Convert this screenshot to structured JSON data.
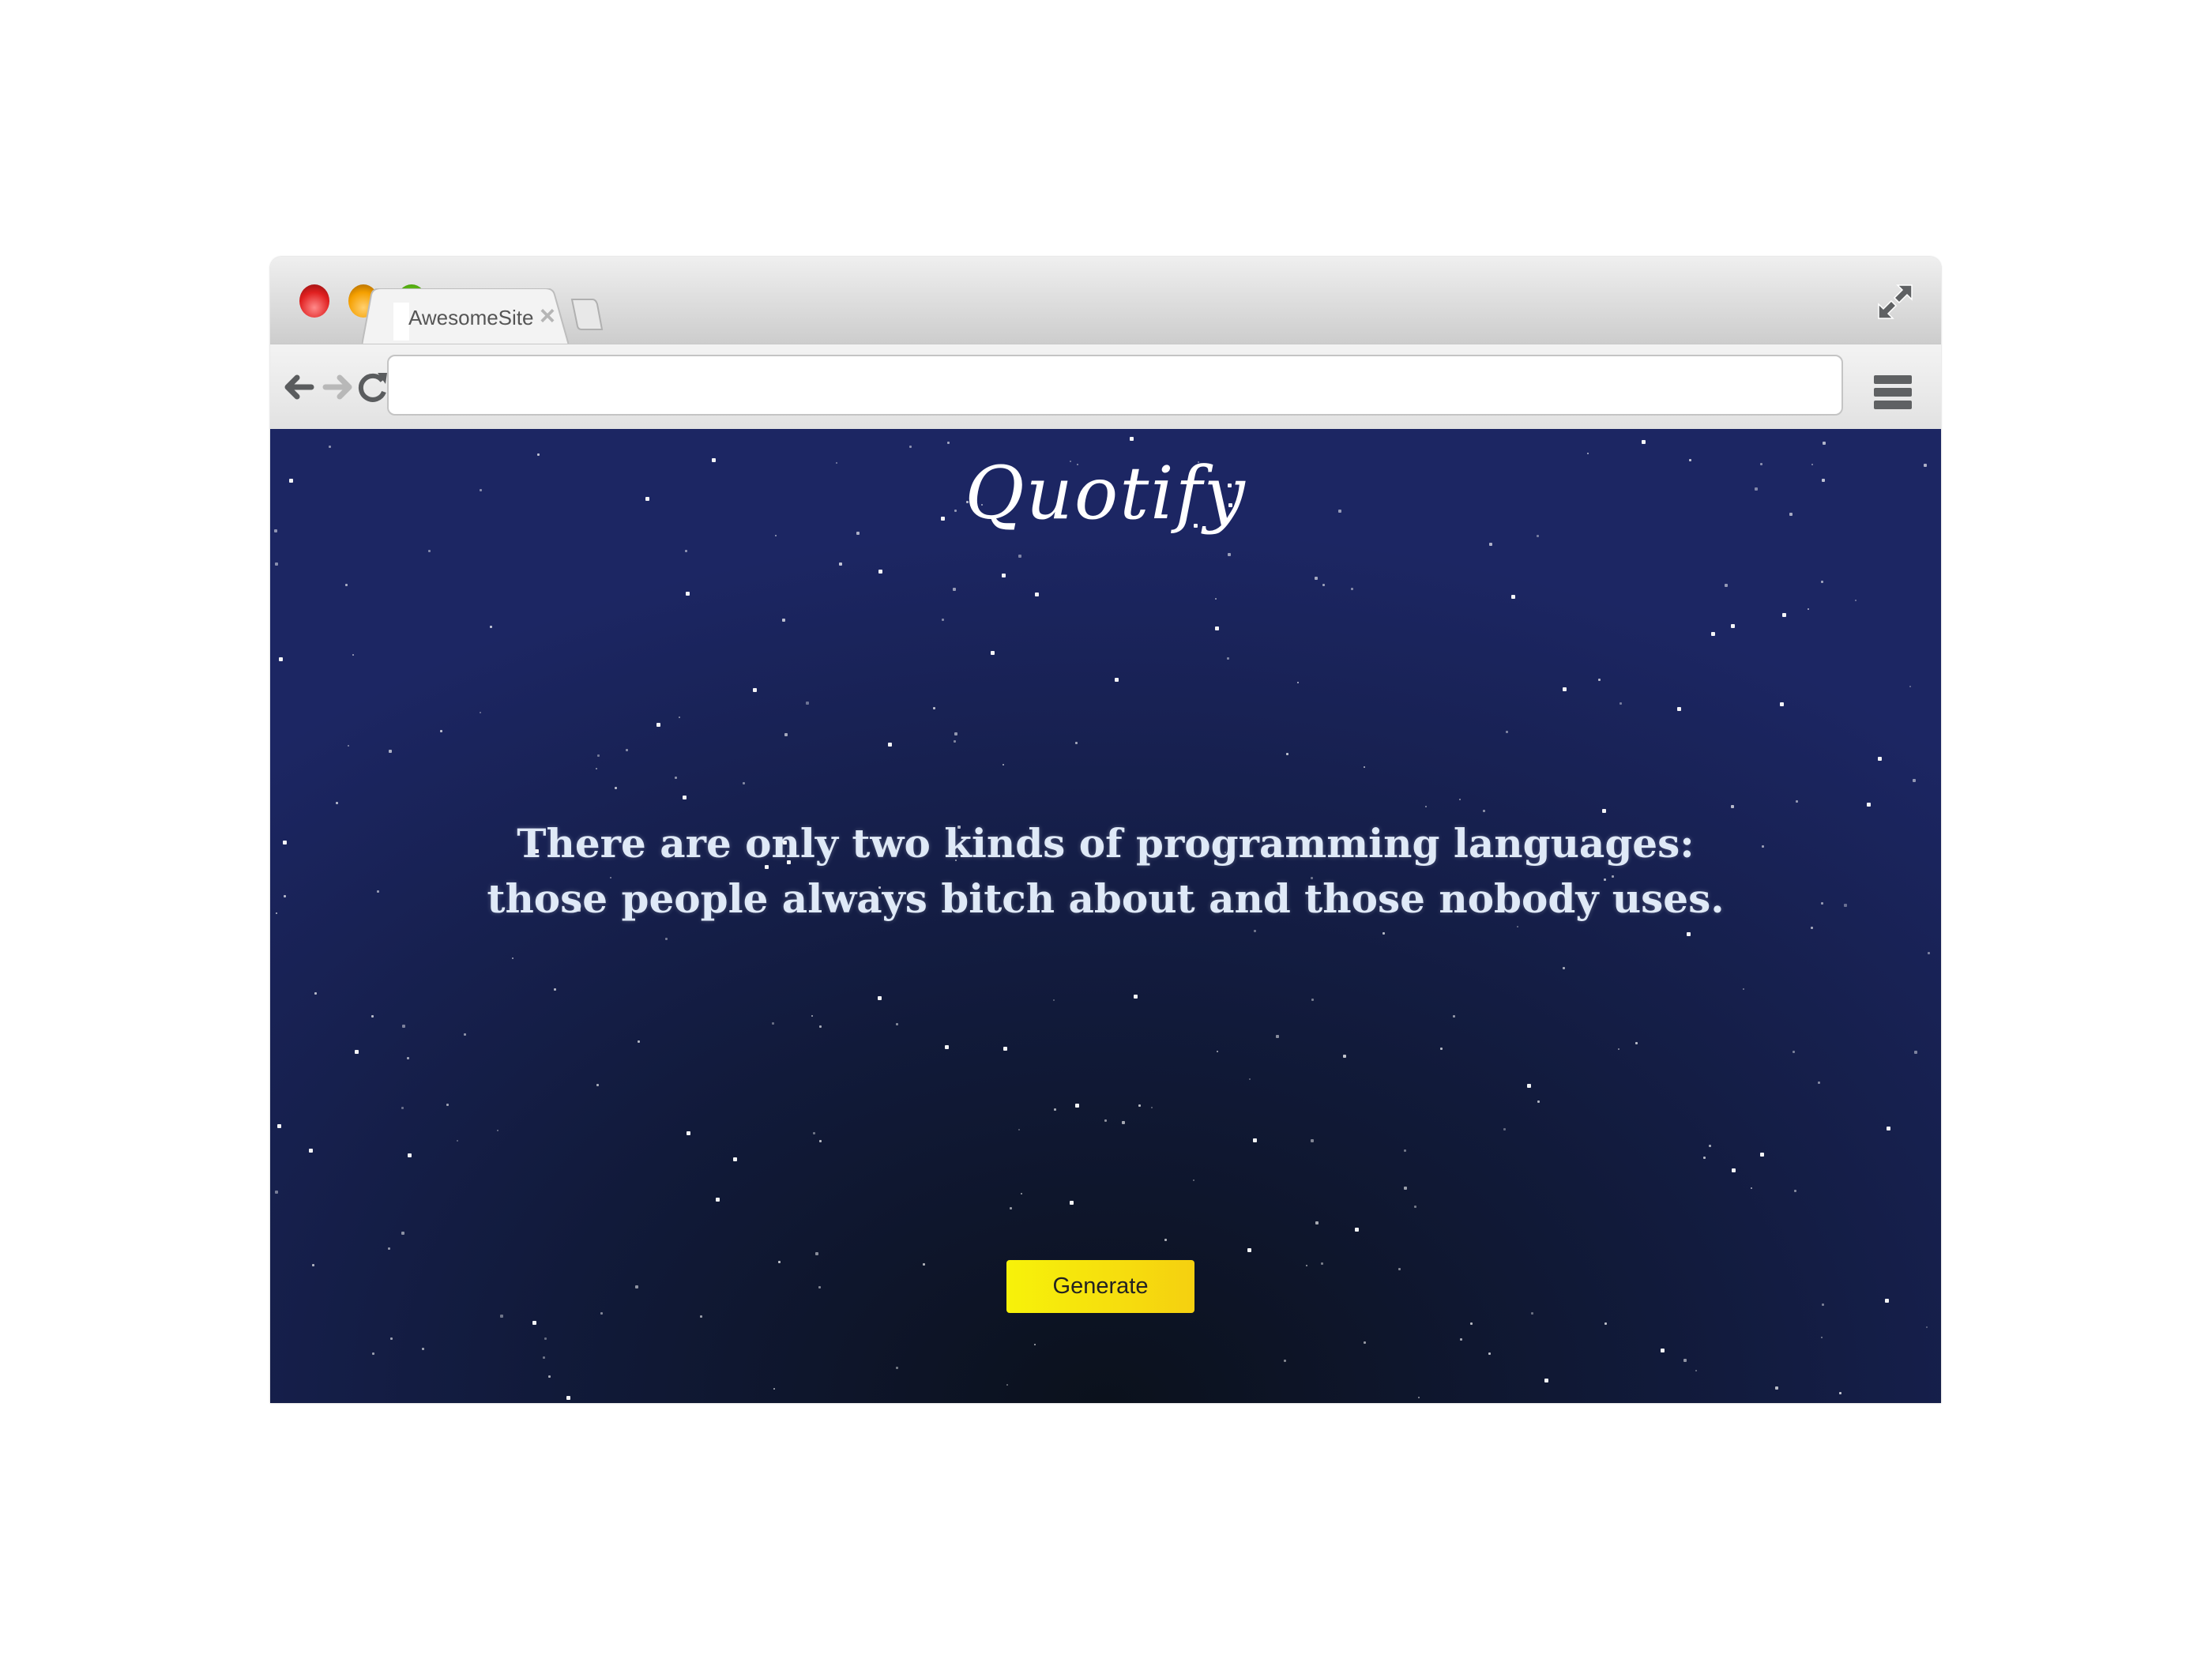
{
  "browser": {
    "tab_title": "AwesomeSite",
    "address_value": "",
    "icons": [
      "back-arrow-icon",
      "forward-arrow-icon",
      "reload-icon",
      "hamburger-menu-icon",
      "fullscreen-expand-icon",
      "close-icon"
    ]
  },
  "page": {
    "logo": "Quotify",
    "quote_line1": "There are only two kinds of programming languages:",
    "quote_line2": "those people always bitch about and those nobody uses.",
    "generate_label": "Generate",
    "colors": {
      "background_edge": "#1c2663",
      "background_center": "#0b111c",
      "button": "#f7f20a",
      "quote_text": "#dfe9f7"
    }
  }
}
